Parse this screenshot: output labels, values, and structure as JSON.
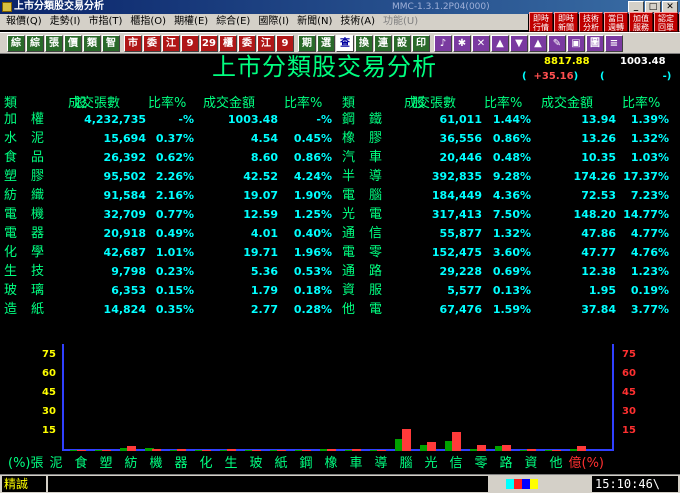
{
  "window": {
    "title": "上市分類股交易分析",
    "version": "MMC-1.3.1.2P04(000)"
  },
  "menu": [
    {
      "label": "報價(Q)",
      "enabled": true
    },
    {
      "label": "走勢(I)",
      "enabled": true
    },
    {
      "label": "市指(T)",
      "enabled": true
    },
    {
      "label": "櫃指(O)",
      "enabled": true
    },
    {
      "label": "期權(E)",
      "enabled": true
    },
    {
      "label": "綜合(E)",
      "enabled": true
    },
    {
      "label": "國際(I)",
      "enabled": true
    },
    {
      "label": "新聞(N)",
      "enabled": true
    },
    {
      "label": "技術(A)",
      "enabled": true
    },
    {
      "label": "功能(U)",
      "enabled": false
    }
  ],
  "quick_buttons": [
    {
      "label": "即時行情"
    },
    {
      "label": "即時新聞"
    },
    {
      "label": "技術分析"
    },
    {
      "label": "當日週轉"
    },
    {
      "label": "加值服務"
    },
    {
      "label": "認定回單"
    },
    {
      "label": "設定連線"
    }
  ],
  "toolbar": [
    {
      "label": "綜",
      "style": "green"
    },
    {
      "label": "綜",
      "style": "green"
    },
    {
      "label": "張",
      "style": "green"
    },
    {
      "label": "價",
      "style": "green"
    },
    {
      "label": "類",
      "style": "green"
    },
    {
      "label": "智",
      "style": "green"
    },
    {
      "label": "市",
      "style": "red"
    },
    {
      "label": "委",
      "style": "red"
    },
    {
      "label": "江",
      "style": "red"
    },
    {
      "label": "9",
      "style": "red"
    },
    {
      "label": "29",
      "style": "red"
    },
    {
      "label": "櫃",
      "style": "red"
    },
    {
      "label": "委",
      "style": "red"
    },
    {
      "label": "江",
      "style": "red"
    },
    {
      "label": "9",
      "style": "red"
    },
    {
      "label": "期",
      "style": "green"
    },
    {
      "label": "選",
      "style": "green"
    },
    {
      "label": "查",
      "style": "white"
    },
    {
      "label": "換",
      "style": "green"
    },
    {
      "label": "連",
      "style": "green"
    },
    {
      "label": "設",
      "style": "green"
    },
    {
      "label": "印",
      "style": "green"
    },
    {
      "label": "♪",
      "style": "purple"
    },
    {
      "label": "✱",
      "style": "purple"
    },
    {
      "label": "✕",
      "style": "purple"
    },
    {
      "label": "▲",
      "style": "purple"
    },
    {
      "label": "▼",
      "style": "purple"
    },
    {
      "label": "▲",
      "style": "purple"
    },
    {
      "label": "✎",
      "style": "purple"
    },
    {
      "label": "▣",
      "style": "purple"
    },
    {
      "label": "圖",
      "style": "purple"
    },
    {
      "label": "≡",
      "style": "purple"
    }
  ],
  "index": {
    "heading": "上市分類股交易分析",
    "value1": "8817.88",
    "value2": "1003.48",
    "change1": "+35.16",
    "change2": "-"
  },
  "columns": {
    "left": {
      "cat": "類　股",
      "vol": "成交張數",
      "vol_pct": "比率%",
      "amt": "成交金額",
      "amt_pct": "比率%"
    },
    "right": {
      "cat": "類　股",
      "vol": "成交張數",
      "vol_pct": "比率%",
      "amt": "成交金額",
      "amt_pct": "比率%"
    }
  },
  "rows_left": [
    {
      "name": "加權",
      "vol": "4,232,735",
      "vol_pct": "-%",
      "amt": "1003.48",
      "amt_pct": "-%"
    },
    {
      "name": "水泥",
      "vol": "15,694",
      "vol_pct": "0.37%",
      "amt": "4.54",
      "amt_pct": "0.45%"
    },
    {
      "name": "食品",
      "vol": "26,392",
      "vol_pct": "0.62%",
      "amt": "8.60",
      "amt_pct": "0.86%"
    },
    {
      "name": "塑膠",
      "vol": "95,502",
      "vol_pct": "2.26%",
      "amt": "42.52",
      "amt_pct": "4.24%"
    },
    {
      "name": "紡織",
      "vol": "91,584",
      "vol_pct": "2.16%",
      "amt": "19.07",
      "amt_pct": "1.90%"
    },
    {
      "name": "電機",
      "vol": "32,709",
      "vol_pct": "0.77%",
      "amt": "12.59",
      "amt_pct": "1.25%"
    },
    {
      "name": "電器",
      "vol": "20,918",
      "vol_pct": "0.49%",
      "amt": "4.01",
      "amt_pct": "0.40%"
    },
    {
      "name": "化學",
      "vol": "42,687",
      "vol_pct": "1.01%",
      "amt": "19.71",
      "amt_pct": "1.96%"
    },
    {
      "name": "生技",
      "vol": "9,798",
      "vol_pct": "0.23%",
      "amt": "5.36",
      "amt_pct": "0.53%"
    },
    {
      "name": "玻璃",
      "vol": "6,353",
      "vol_pct": "0.15%",
      "amt": "1.79",
      "amt_pct": "0.18%"
    },
    {
      "name": "造紙",
      "vol": "14,824",
      "vol_pct": "0.35%",
      "amt": "2.77",
      "amt_pct": "0.28%"
    }
  ],
  "rows_right": [
    {
      "name": "鋼鐵",
      "vol": "61,011",
      "vol_pct": "1.44%",
      "amt": "13.94",
      "amt_pct": "1.39%"
    },
    {
      "name": "橡膠",
      "vol": "36,556",
      "vol_pct": "0.86%",
      "amt": "13.26",
      "amt_pct": "1.32%"
    },
    {
      "name": "汽車",
      "vol": "20,446",
      "vol_pct": "0.48%",
      "amt": "10.35",
      "amt_pct": "1.03%"
    },
    {
      "name": "半導",
      "vol": "392,835",
      "vol_pct": "9.28%",
      "amt": "174.26",
      "amt_pct": "17.37%"
    },
    {
      "name": "電腦",
      "vol": "184,449",
      "vol_pct": "4.36%",
      "amt": "72.53",
      "amt_pct": "7.23%"
    },
    {
      "name": "光電",
      "vol": "317,413",
      "vol_pct": "7.50%",
      "amt": "148.20",
      "amt_pct": "14.77%"
    },
    {
      "name": "通信",
      "vol": "55,877",
      "vol_pct": "1.32%",
      "amt": "47.86",
      "amt_pct": "4.77%"
    },
    {
      "name": "電零",
      "vol": "152,475",
      "vol_pct": "3.60%",
      "amt": "47.77",
      "amt_pct": "4.76%"
    },
    {
      "name": "通路",
      "vol": "29,228",
      "vol_pct": "0.69%",
      "amt": "12.38",
      "amt_pct": "1.23%"
    },
    {
      "name": "資服",
      "vol": "5,577",
      "vol_pct": "0.13%",
      "amt": "1.95",
      "amt_pct": "0.19%"
    },
    {
      "name": "他電",
      "vol": "67,476",
      "vol_pct": "1.59%",
      "amt": "37.84",
      "amt_pct": "3.77%"
    }
  ],
  "chart_data": {
    "type": "bar",
    "categories": [
      "泥",
      "食",
      "塑",
      "紡",
      "機",
      "器",
      "化",
      "生",
      "玻",
      "紙",
      "鋼",
      "橡",
      "車",
      "導",
      "腦",
      "光",
      "信",
      "零",
      "路",
      "資",
      "他"
    ],
    "series": [
      {
        "values": [
          0.37,
          0.62,
          2.26,
          2.16,
          0.77,
          0.49,
          1.01,
          0.23,
          0.15,
          0.35,
          1.44,
          0.86,
          0.48,
          9.28,
          4.36,
          7.5,
          1.32,
          3.6,
          0.69,
          0.13,
          1.59
        ]
      },
      {
        "values": [
          0.45,
          0.86,
          4.24,
          1.9,
          1.25,
          0.4,
          1.96,
          0.53,
          0.18,
          0.28,
          1.39,
          1.32,
          1.03,
          17.37,
          7.23,
          14.77,
          4.77,
          4.76,
          1.23,
          0.19,
          3.77
        ]
      }
    ],
    "ylim": [
      0,
      80
    ],
    "left_ticks": [
      "75",
      "60",
      "45",
      "30",
      "15"
    ],
    "right_ticks": [
      "75",
      "60",
      "45",
      "30",
      "15"
    ],
    "xlabel_left": "(%)張",
    "xlabel_right": "億(%)",
    "colors": {
      "vol": "#00a000",
      "amt": "#ff3a3a",
      "axis": "#3040ff"
    }
  },
  "status": {
    "label": "精誠",
    "clock": "15:10:46\\",
    "indicator_colors": [
      "#00ffff",
      "#ff2020",
      "#0000ff",
      "#ffff00"
    ]
  }
}
